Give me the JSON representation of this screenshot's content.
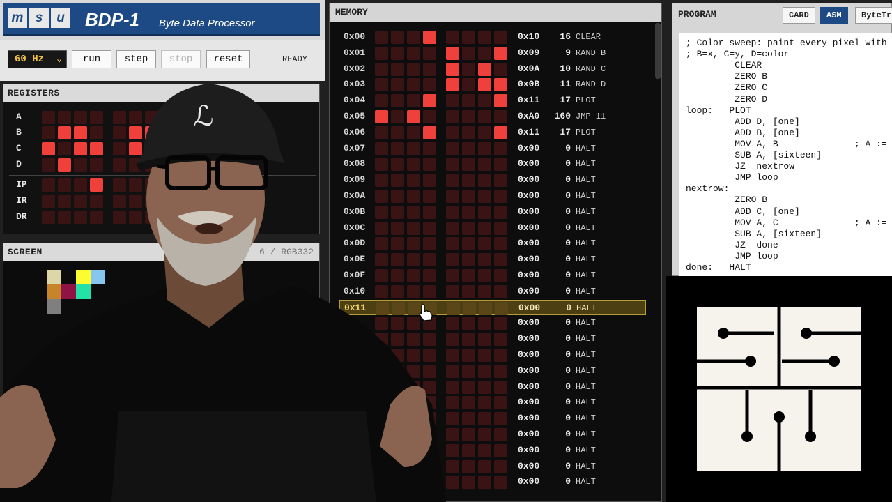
{
  "header": {
    "logo_letters": [
      "m",
      "s",
      "u"
    ],
    "title": "BDP-1",
    "subtitle": "Byte Data Processor"
  },
  "controls": {
    "clock": "60 Hz",
    "run": "run",
    "step": "step",
    "stop": "stop",
    "reset": "reset",
    "status": "READY"
  },
  "registers": {
    "title": "REGISTERS",
    "rows": [
      {
        "name": "A",
        "bits": [
          0,
          0,
          0,
          0,
          0,
          0,
          0,
          0
        ]
      },
      {
        "name": "B",
        "bits": [
          0,
          1,
          1,
          0,
          0,
          1,
          1,
          0
        ]
      },
      {
        "name": "C",
        "bits": [
          1,
          0,
          1,
          1,
          0,
          1,
          1,
          0
        ]
      },
      {
        "name": "D",
        "bits": [
          0,
          1,
          0,
          0,
          0,
          0,
          0,
          0
        ]
      },
      {
        "name": "IP",
        "bits": [
          0,
          0,
          0,
          1,
          0,
          0,
          0,
          0
        ]
      },
      {
        "name": "IR",
        "bits": [
          0,
          0,
          0,
          0,
          0,
          0,
          0,
          0
        ]
      },
      {
        "name": "DR",
        "bits": [
          0,
          0,
          0,
          0,
          0,
          0,
          0,
          0
        ]
      }
    ]
  },
  "screen": {
    "title": "SCREEN",
    "mode": "6 / RGB332",
    "pixels": [
      "#ddd6a6",
      "#fcfc2e",
      "#88c6f2",
      "#c7842a",
      "#8f1445",
      "#23e2a8",
      "#7f7f7f"
    ]
  },
  "memory": {
    "title": "MEMORY",
    "rows": [
      {
        "addr": "0x00",
        "bits": [
          0,
          0,
          0,
          1,
          0,
          0,
          0,
          0
        ],
        "hex": "0x10",
        "dec": "16",
        "mnem": "CLEAR"
      },
      {
        "addr": "0x01",
        "bits": [
          0,
          0,
          0,
          0,
          1,
          0,
          0,
          1
        ],
        "hex": "0x09",
        "dec": "9",
        "mnem": "RAND B"
      },
      {
        "addr": "0x02",
        "bits": [
          0,
          0,
          0,
          0,
          1,
          0,
          1,
          0
        ],
        "hex": "0x0A",
        "dec": "10",
        "mnem": "RAND C"
      },
      {
        "addr": "0x03",
        "bits": [
          0,
          0,
          0,
          0,
          1,
          0,
          1,
          1
        ],
        "hex": "0x0B",
        "dec": "11",
        "mnem": "RAND D"
      },
      {
        "addr": "0x04",
        "bits": [
          0,
          0,
          0,
          1,
          0,
          0,
          0,
          1
        ],
        "hex": "0x11",
        "dec": "17",
        "mnem": "PLOT"
      },
      {
        "addr": "0x05",
        "bits": [
          1,
          0,
          1,
          0,
          0,
          0,
          0,
          0
        ],
        "hex": "0xA0",
        "dec": "160",
        "mnem": "JMP 11"
      },
      {
        "addr": "0x06",
        "bits": [
          0,
          0,
          0,
          1,
          0,
          0,
          0,
          1
        ],
        "hex": "0x11",
        "dec": "17",
        "mnem": "PLOT"
      },
      {
        "addr": "0x07",
        "bits": [
          0,
          0,
          0,
          0,
          0,
          0,
          0,
          0
        ],
        "hex": "0x00",
        "dec": "0",
        "mnem": "HALT"
      },
      {
        "addr": "0x08",
        "bits": [
          0,
          0,
          0,
          0,
          0,
          0,
          0,
          0
        ],
        "hex": "0x00",
        "dec": "0",
        "mnem": "HALT"
      },
      {
        "addr": "0x09",
        "bits": [
          0,
          0,
          0,
          0,
          0,
          0,
          0,
          0
        ],
        "hex": "0x00",
        "dec": "0",
        "mnem": "HALT"
      },
      {
        "addr": "0x0A",
        "bits": [
          0,
          0,
          0,
          0,
          0,
          0,
          0,
          0
        ],
        "hex": "0x00",
        "dec": "0",
        "mnem": "HALT"
      },
      {
        "addr": "0x0B",
        "bits": [
          0,
          0,
          0,
          0,
          0,
          0,
          0,
          0
        ],
        "hex": "0x00",
        "dec": "0",
        "mnem": "HALT"
      },
      {
        "addr": "0x0C",
        "bits": [
          0,
          0,
          0,
          0,
          0,
          0,
          0,
          0
        ],
        "hex": "0x00",
        "dec": "0",
        "mnem": "HALT"
      },
      {
        "addr": "0x0D",
        "bits": [
          0,
          0,
          0,
          0,
          0,
          0,
          0,
          0
        ],
        "hex": "0x00",
        "dec": "0",
        "mnem": "HALT"
      },
      {
        "addr": "0x0E",
        "bits": [
          0,
          0,
          0,
          0,
          0,
          0,
          0,
          0
        ],
        "hex": "0x00",
        "dec": "0",
        "mnem": "HALT"
      },
      {
        "addr": "0x0F",
        "bits": [
          0,
          0,
          0,
          0,
          0,
          0,
          0,
          0
        ],
        "hex": "0x00",
        "dec": "0",
        "mnem": "HALT"
      },
      {
        "addr": "0x10",
        "bits": [
          0,
          0,
          0,
          0,
          0,
          0,
          0,
          0
        ],
        "hex": "0x00",
        "dec": "0",
        "mnem": "HALT"
      },
      {
        "addr": "0x11",
        "bits": [
          0,
          0,
          0,
          0,
          0,
          0,
          0,
          0
        ],
        "hex": "0x00",
        "dec": "0",
        "mnem": "HALT",
        "highlight": true
      },
      {
        "addr": "",
        "bits": [
          0,
          0,
          0,
          0,
          0,
          0,
          0,
          0
        ],
        "hex": "0x00",
        "dec": "0",
        "mnem": "HALT"
      },
      {
        "addr": "",
        "bits": [
          0,
          0,
          0,
          0,
          0,
          0,
          0,
          0
        ],
        "hex": "0x00",
        "dec": "0",
        "mnem": "HALT"
      },
      {
        "addr": "",
        "bits": [
          0,
          0,
          0,
          0,
          0,
          0,
          0,
          0
        ],
        "hex": "0x00",
        "dec": "0",
        "mnem": "HALT"
      },
      {
        "addr": "",
        "bits": [
          0,
          0,
          0,
          0,
          0,
          0,
          0,
          0
        ],
        "hex": "0x00",
        "dec": "0",
        "mnem": "HALT"
      },
      {
        "addr": "",
        "bits": [
          0,
          0,
          0,
          0,
          0,
          0,
          0,
          0
        ],
        "hex": "0x00",
        "dec": "0",
        "mnem": "HALT"
      },
      {
        "addr": "",
        "bits": [
          0,
          0,
          0,
          0,
          0,
          0,
          0,
          0
        ],
        "hex": "0x00",
        "dec": "0",
        "mnem": "HALT"
      },
      {
        "addr": "",
        "bits": [
          0,
          0,
          0,
          0,
          0,
          0,
          0,
          0
        ],
        "hex": "0x00",
        "dec": "0",
        "mnem": "HALT"
      },
      {
        "addr": "",
        "bits": [
          0,
          0,
          0,
          0,
          0,
          0,
          0,
          0
        ],
        "hex": "0x00",
        "dec": "0",
        "mnem": "HALT"
      },
      {
        "addr": "",
        "bits": [
          0,
          0,
          0,
          0,
          0,
          0,
          0,
          0
        ],
        "hex": "0x00",
        "dec": "0",
        "mnem": "HALT"
      },
      {
        "addr": "",
        "bits": [
          0,
          0,
          0,
          0,
          0,
          0,
          0,
          0
        ],
        "hex": "0x00",
        "dec": "0",
        "mnem": "HALT"
      },
      {
        "addr": "",
        "bits": [
          0,
          0,
          0,
          0,
          0,
          0,
          0,
          0
        ],
        "hex": "0x00",
        "dec": "0",
        "mnem": "HALT"
      }
    ]
  },
  "program": {
    "title": "PROGRAM",
    "tabs": [
      {
        "label": "CARD",
        "active": false
      },
      {
        "label": "ASM",
        "active": true
      },
      {
        "label": "ByteTr",
        "active": false
      }
    ],
    "lines": [
      "; Color sweep: paint every pixel with",
      "; B=x, C=y, D=color",
      "         CLEAR",
      "         ZERO B",
      "         ZERO C",
      "         ZERO D",
      "loop:   PLOT",
      "         ADD D, [one]",
      "         ADD B, [one]",
      "         MOV A, B              ; A :=",
      "         SUB A, [sixteen]",
      "         JZ  nextrow",
      "         JMP loop",
      "nextrow:",
      "         ZERO B",
      "         ADD C, [one]",
      "         MOV A, C              ; A :=",
      "         SUB A, [sixteen]",
      "         JZ  done",
      "         JMP loop",
      "done:   HALT"
    ]
  }
}
